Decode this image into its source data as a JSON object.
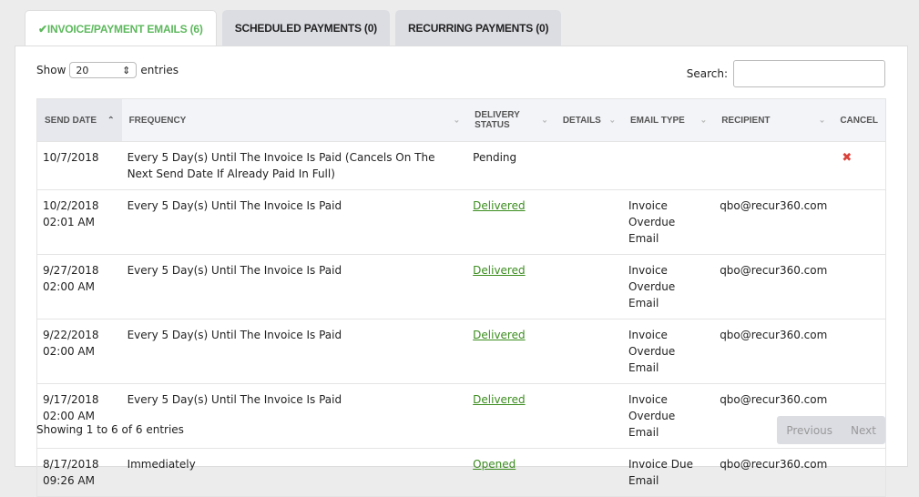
{
  "tabs": [
    {
      "label": "INVOICE/PAYMENT EMAILS (6)",
      "icon": "check-icon",
      "active": true
    },
    {
      "label": "SCHEDULED PAYMENTS (0)"
    },
    {
      "label": "RECURRING PAYMENTS (0)"
    }
  ],
  "length": {
    "show": "Show",
    "value": "20",
    "entries": "entries"
  },
  "search": {
    "label": "Search:",
    "value": ""
  },
  "columns": [
    "SEND DATE",
    "FREQUENCY",
    "DELIVERY STATUS",
    "DETAILS",
    "EMAIL TYPE",
    "RECIPIENT",
    "CANCEL"
  ],
  "rows": [
    {
      "date": "10/7/2018",
      "time": "",
      "frequency": "Every 5 Day(s) Until The Invoice Is Paid (Cancels On The Next Send Date If Already Paid In Full)",
      "status": "Pending",
      "details": "",
      "type": "",
      "recipient": "",
      "cancel": true
    },
    {
      "date": "10/2/2018",
      "time": "02:01 AM",
      "frequency": "Every 5 Day(s) Until The Invoice Is Paid",
      "status": "Delivered",
      "details": "",
      "type": "Invoice Overdue Email",
      "recipient": "qbo@recur360.com"
    },
    {
      "date": "9/27/2018",
      "time": "02:00 AM",
      "frequency": "Every 5 Day(s) Until The Invoice Is Paid",
      "status": "Delivered",
      "details": "",
      "type": "Invoice Overdue Email",
      "recipient": "qbo@recur360.com"
    },
    {
      "date": "9/22/2018",
      "time": "02:00 AM",
      "frequency": "Every 5 Day(s) Until The Invoice Is Paid",
      "status": "Delivered",
      "details": "",
      "type": "Invoice Overdue Email",
      "recipient": "qbo@recur360.com"
    },
    {
      "date": "9/17/2018",
      "time": "02:00 AM",
      "frequency": "Every 5 Day(s) Until The Invoice Is Paid",
      "status": "Delivered",
      "details": "",
      "type": "Invoice Overdue Email",
      "recipient": "qbo@recur360.com"
    },
    {
      "date": "8/17/2018",
      "time": "09:26 AM",
      "frequency": "Immediately",
      "status": "Opened",
      "details": "",
      "type": "Invoice Due Email",
      "recipient": "qbo@recur360.com"
    }
  ],
  "footer": {
    "info": "Showing 1 to 6 of 6 entries",
    "previous": "Previous",
    "next": "Next"
  },
  "colors": {
    "accent": "#5cb85c",
    "link": "#3c8d1f",
    "cancel": "#d9413a"
  }
}
